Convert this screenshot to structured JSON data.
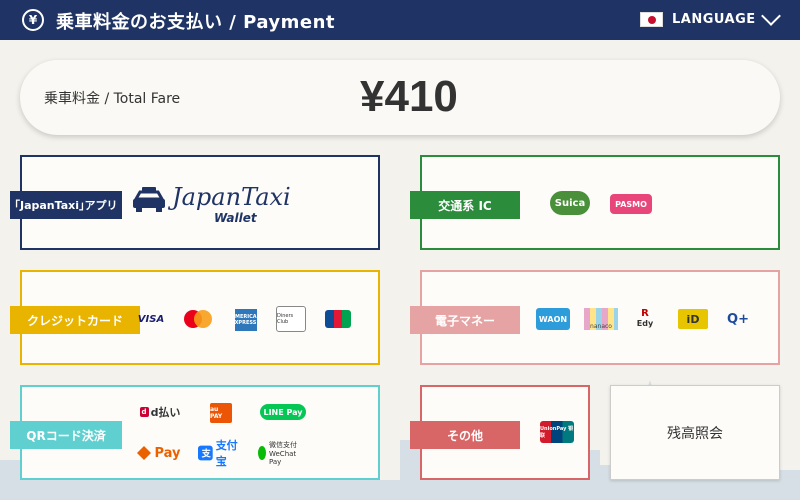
{
  "header": {
    "title": "乗車料金のお支払い / Payment",
    "yen_glyph": "¥",
    "language_label": "LANGUAGE"
  },
  "fare": {
    "label": "乗車料金 /  Total Fare",
    "amount": "¥410"
  },
  "methods": {
    "japantaxi": {
      "label": "｢JapanTaxi｣アプリ",
      "logo_word": "JapanTaxi",
      "logo_sub": "Wallet",
      "color": "#1f3464"
    },
    "transit_ic": {
      "label": "交通系 IC",
      "logos": [
        "Suica",
        "PASMO"
      ],
      "color": "#2b8c3c"
    },
    "credit_card": {
      "label": "クレジットカード",
      "logos": [
        "VISA",
        "AMERICAN EXPRESS",
        "Diners Club"
      ],
      "color": "#e8b400"
    },
    "e_money": {
      "label": "電子マネー",
      "logos": [
        "WAON",
        "nanaco",
        "R",
        "Edy",
        "iD",
        "Q+"
      ],
      "color": "#e5a3a3"
    },
    "qr_code": {
      "label": "QRコード決済",
      "logos": [
        "d払い",
        "au PAY",
        "LINE Pay",
        "Pay",
        "支付宝",
        "微信支付 WeChat Pay"
      ],
      "color": "#5fcfd0"
    },
    "other": {
      "label": "その他",
      "logos": [
        "UnionPay 银联"
      ],
      "color": "#d96666"
    }
  },
  "balance": {
    "label": "残高照会"
  }
}
